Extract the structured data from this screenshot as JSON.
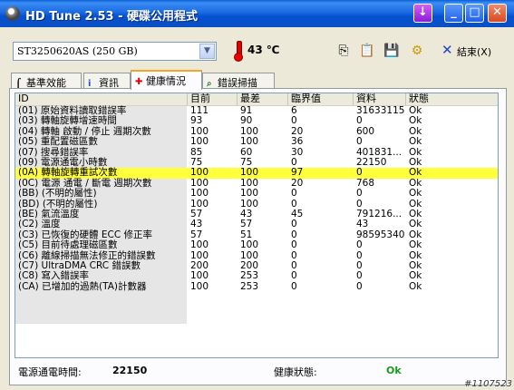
{
  "window": {
    "title": "HD Tune 2.53 - 硬碟公用程式"
  },
  "toolbar": {
    "drive": "ST3250620AS (250 GB)",
    "temperature": "43 ℃",
    "exit_label": "結束(X)"
  },
  "tabs": [
    {
      "label": "基準效能",
      "icon": "benchmark-icon"
    },
    {
      "label": "資訊",
      "icon": "info-icon"
    },
    {
      "label": "健康情況",
      "icon": "health-cross-icon",
      "active": true
    },
    {
      "label": "錯誤掃描",
      "icon": "search-icon"
    }
  ],
  "table": {
    "columns": [
      "ID",
      "目前",
      "最差",
      "臨界值",
      "資料",
      "狀態"
    ],
    "rows": [
      [
        "(01) 原始資料讀取錯誤率",
        "111",
        "91",
        "6",
        "31633115",
        "Ok"
      ],
      [
        "(03) 轉軸旋轉增速時間",
        "93",
        "90",
        "0",
        "0",
        "Ok"
      ],
      [
        "(04) 轉軸 啟動 / 停止 週期次數",
        "100",
        "100",
        "20",
        "600",
        "Ok"
      ],
      [
        "(05) 重配置磁區數",
        "100",
        "100",
        "36",
        "0",
        "Ok"
      ],
      [
        "(07) 搜尋錯誤率",
        "85",
        "60",
        "30",
        "401831...",
        "Ok"
      ],
      [
        "(09) 電源通電小時數",
        "75",
        "75",
        "0",
        "22150",
        "Ok"
      ],
      [
        "(0A) 轉軸旋轉重試次數",
        "100",
        "100",
        "97",
        "0",
        "Ok"
      ],
      [
        "(0C) 電源 通電 / 斷電 週期次數",
        "100",
        "100",
        "20",
        "768",
        "Ok"
      ],
      [
        "(BB) (不明的屬性)",
        "100",
        "100",
        "0",
        "0",
        "Ok"
      ],
      [
        "(BD) (不明的屬性)",
        "100",
        "100",
        "0",
        "0",
        "Ok"
      ],
      [
        "(BE) 氣流溫度",
        "57",
        "43",
        "45",
        "791216...",
        "Ok"
      ],
      [
        "(C2) 溫度",
        "43",
        "57",
        "0",
        "43",
        "Ok"
      ],
      [
        "(C3) 已恢復的硬體 ECC 修正率",
        "57",
        "51",
        "0",
        "98595340",
        "Ok"
      ],
      [
        "(C5) 目前待處理磁區數",
        "100",
        "100",
        "0",
        "0",
        "Ok"
      ],
      [
        "(C6) 離線掃描無法修正的錯誤數",
        "100",
        "100",
        "0",
        "0",
        "Ok"
      ],
      [
        "(C7) UltraDMA CRC 錯誤數",
        "200",
        "200",
        "0",
        "0",
        "Ok"
      ],
      [
        "(C8) 寫入錯誤率",
        "100",
        "253",
        "0",
        "0",
        "Ok"
      ],
      [
        "(CA) 已增加的過熱(TA)計數器",
        "100",
        "253",
        "0",
        "0",
        "Ok"
      ]
    ],
    "highlight_row": 6
  },
  "status": {
    "power_on_label": "電源通電時間:",
    "power_on_value": "22150",
    "health_label": "健康狀態:",
    "health_value": "Ok"
  },
  "watermark": "#1107523",
  "colors": {
    "highlight": "#ffff3c",
    "ok_green": "#1a9a1a",
    "titlebar": "#0a4fc4"
  }
}
